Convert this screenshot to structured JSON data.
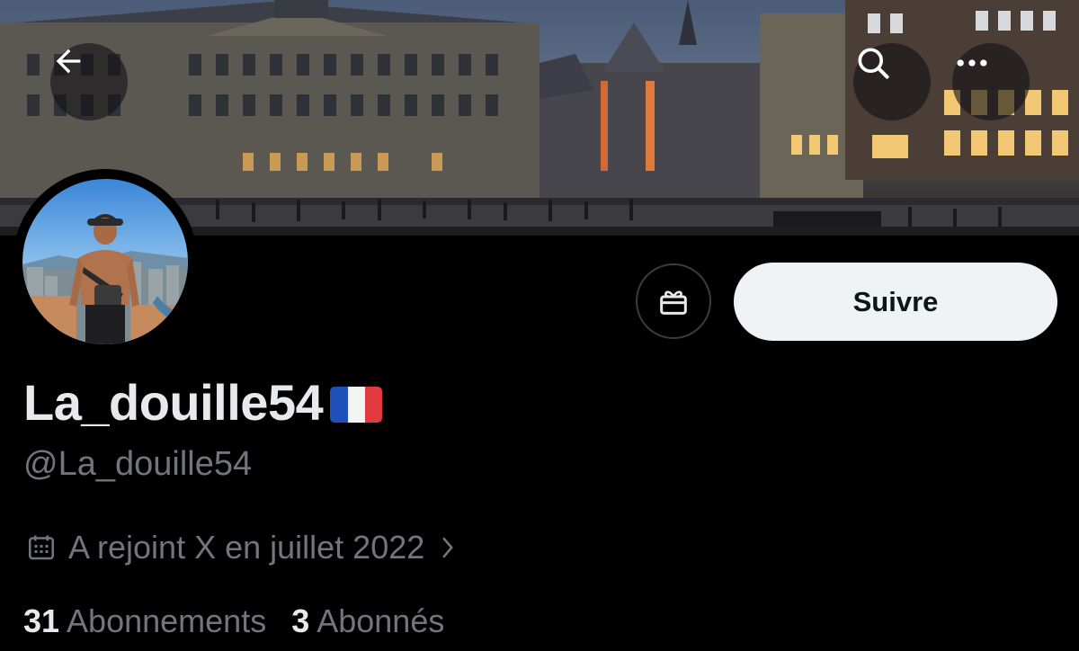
{
  "header": {
    "back_icon": "arrow-left-icon",
    "search_icon": "search-icon",
    "more_icon": "more-horizontal-icon"
  },
  "profile": {
    "display_name": "La_douille54",
    "flag_emoji": "🇫🇷",
    "handle": "@La_douille54",
    "joined": "A rejoint X en juillet 2022",
    "follow_label": "Suivre"
  },
  "stats": {
    "following_count": "31",
    "following_label": "Abonnements",
    "followers_count": "3",
    "followers_label": "Abonnés"
  },
  "colors": {
    "background": "#000000",
    "primary_text": "#e7e9ea",
    "secondary_text": "#71767b",
    "follow_button_bg": "#eff3f4"
  }
}
